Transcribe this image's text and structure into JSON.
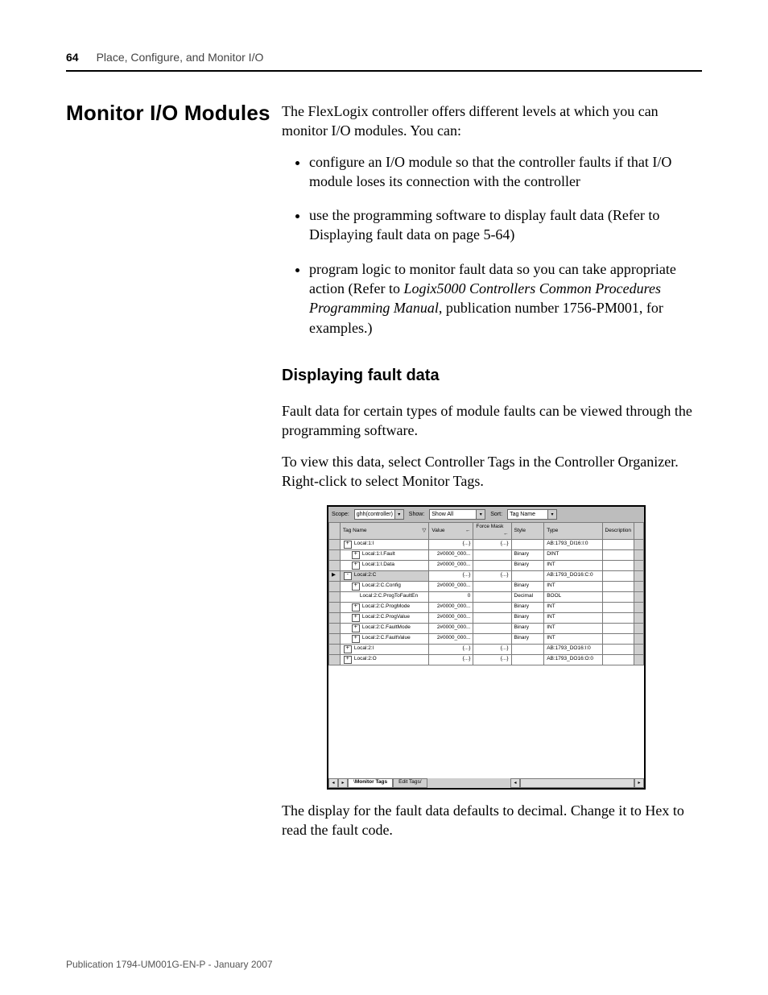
{
  "header": {
    "page_number": "64",
    "chapter": "Place, Configure, and Monitor I/O"
  },
  "section": {
    "title": "Monitor I/O Modules"
  },
  "intro": "The FlexLogix controller offers different levels at which you can monitor I/O modules. You can:",
  "bullets": [
    "configure an I/O module so that the controller faults if that I/O module loses its connection with the controller",
    "use the programming software to display fault data (Refer to Displaying fault data on page 5-64)",
    {
      "pre": "program logic to monitor fault data so you can take appropriate action (Refer to ",
      "ital": "Logix5000 Controllers Common Procedures Programming Manual",
      "post": ", publication number 1756-PM001, for examples.)"
    }
  ],
  "subheading": "Displaying fault data",
  "para1": "Fault data for certain types of module faults can be viewed through the programming software.",
  "para2": "To view this data, select Controller Tags in the Controller Organizer. Right-click to select Monitor Tags.",
  "para3": "The display for the fault data defaults to decimal. Change it to Hex to read the fault code.",
  "screenshot": {
    "toolbar": {
      "scope_label": "Scope:",
      "scope_value": "ghh(controller)",
      "show_label": "Show:",
      "show_value": "Show All",
      "sort_label": "Sort:",
      "sort_value": "Tag Name"
    },
    "columns": [
      "Tag Name",
      "Value",
      "Force Mask",
      "Style",
      "Type",
      "Description"
    ],
    "rows": [
      {
        "name": "Local:1:I",
        "value": "{...}",
        "force": "{...}",
        "style": "",
        "type": "AB:1793_DI16:I:0",
        "ind": 0,
        "sym": "+"
      },
      {
        "name": "Local:1:I.Fault",
        "value": "2#0000_000...",
        "force": "",
        "style": "Binary",
        "type": "DINT",
        "ind": 1,
        "sym": "+"
      },
      {
        "name": "Local:1:I.Data",
        "value": "2#0000_000...",
        "force": "",
        "style": "Binary",
        "type": "INT",
        "ind": 1,
        "sym": "+"
      },
      {
        "name": "Local:2:C",
        "value": "{...}",
        "force": "{...}",
        "style": "",
        "type": "AB:1793_DO16:C:0",
        "ind": 0,
        "sym": "-",
        "hl": true
      },
      {
        "name": "Local:2:C.Config",
        "value": "2#0000_000...",
        "force": "",
        "style": "Binary",
        "type": "INT",
        "ind": 1,
        "sym": "+"
      },
      {
        "name": "Local:2:C.ProgToFaultEn",
        "value": "0",
        "force": "",
        "style": "Decimal",
        "type": "BOOL",
        "ind": 2,
        "sym": ""
      },
      {
        "name": "Local:2:C.ProgMode",
        "value": "2#0000_000...",
        "force": "",
        "style": "Binary",
        "type": "INT",
        "ind": 1,
        "sym": "+"
      },
      {
        "name": "Local:2:C.ProgValue",
        "value": "2#0000_000...",
        "force": "",
        "style": "Binary",
        "type": "INT",
        "ind": 1,
        "sym": "+"
      },
      {
        "name": "Local:2:C.FaultMode",
        "value": "2#0000_000...",
        "force": "",
        "style": "Binary",
        "type": "INT",
        "ind": 1,
        "sym": "+"
      },
      {
        "name": "Local:2:C.FaultValue",
        "value": "2#0000_000...",
        "force": "",
        "style": "Binary",
        "type": "INT",
        "ind": 1,
        "sym": "+"
      },
      {
        "name": "Local:2:I",
        "value": "{...}",
        "force": "{...}",
        "style": "",
        "type": "AB:1793_DO16:I:0",
        "ind": 0,
        "sym": "+"
      },
      {
        "name": "Local:2:O",
        "value": "{...}",
        "force": "{...}",
        "style": "",
        "type": "AB:1793_DO16:O:0",
        "ind": 0,
        "sym": "+"
      }
    ],
    "tabs": {
      "active": "Monitor Tags",
      "inactive": "Edit Tags"
    }
  },
  "footer": "Publication 1794-UM001G-EN-P - January 2007"
}
